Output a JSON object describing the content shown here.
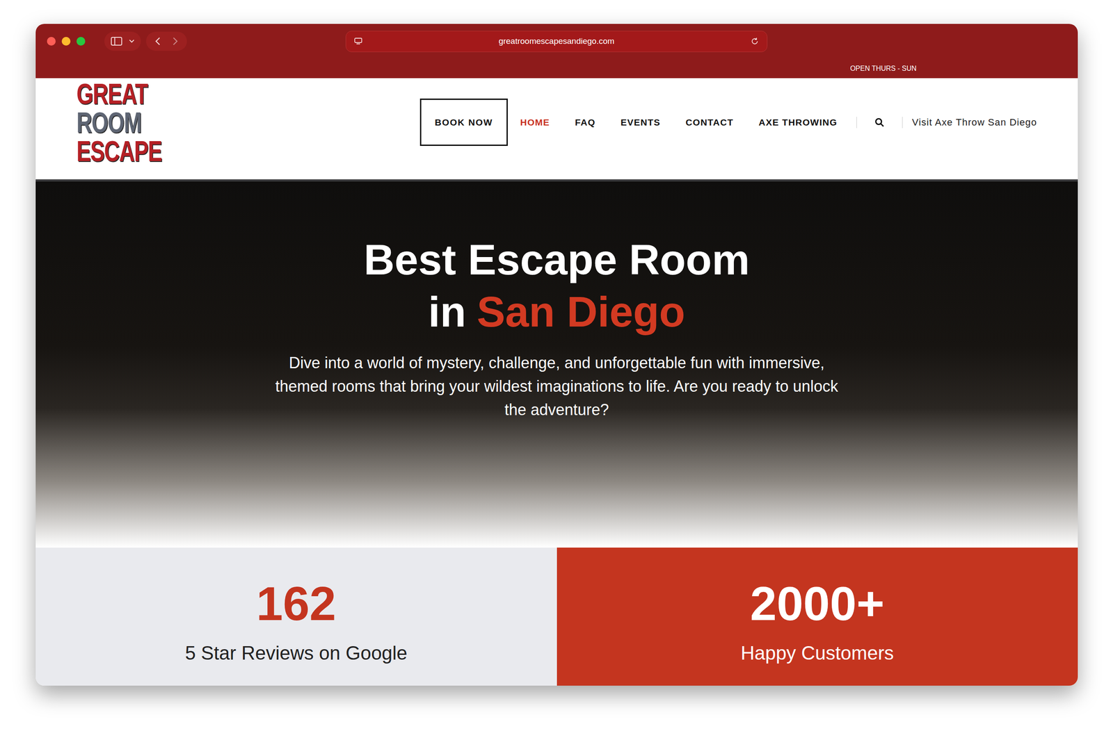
{
  "browser": {
    "url": "greatroomescapesandiego.com"
  },
  "top_bar": {
    "hours": "OPEN THURS - SUN"
  },
  "logo": {
    "lines": [
      {
        "text": "GREAT",
        "color": "#b52025"
      },
      {
        "text": "ROOM",
        "color": "#5e6573"
      },
      {
        "text": "ESCAPE",
        "color": "#b52025"
      }
    ]
  },
  "nav": {
    "book_button": "BOOK NOW",
    "items": [
      {
        "label": "HOME",
        "selected": true
      },
      {
        "label": "FAQ",
        "selected": false
      },
      {
        "label": "EVENTS",
        "selected": false
      },
      {
        "label": "CONTACT",
        "selected": false
      },
      {
        "label": "AXE THROWING",
        "selected": false
      }
    ],
    "external_link": "Visit Axe Throw San Diego"
  },
  "hero": {
    "title_line_1": "Best Escape Room",
    "title_line_2": "in",
    "title_highlight": "San Diego",
    "description": "Dive into a world of mystery, challenge, and unforgettable fun with immersive, themed rooms that bring your wildest imaginations to life. Are you ready to unlock the adventure?"
  },
  "stats": [
    {
      "value": "162",
      "label": "5 Star Reviews on Google",
      "kind": "light"
    },
    {
      "value": "2000+",
      "label": "Happy Customers",
      "kind": "accent"
    }
  ]
}
